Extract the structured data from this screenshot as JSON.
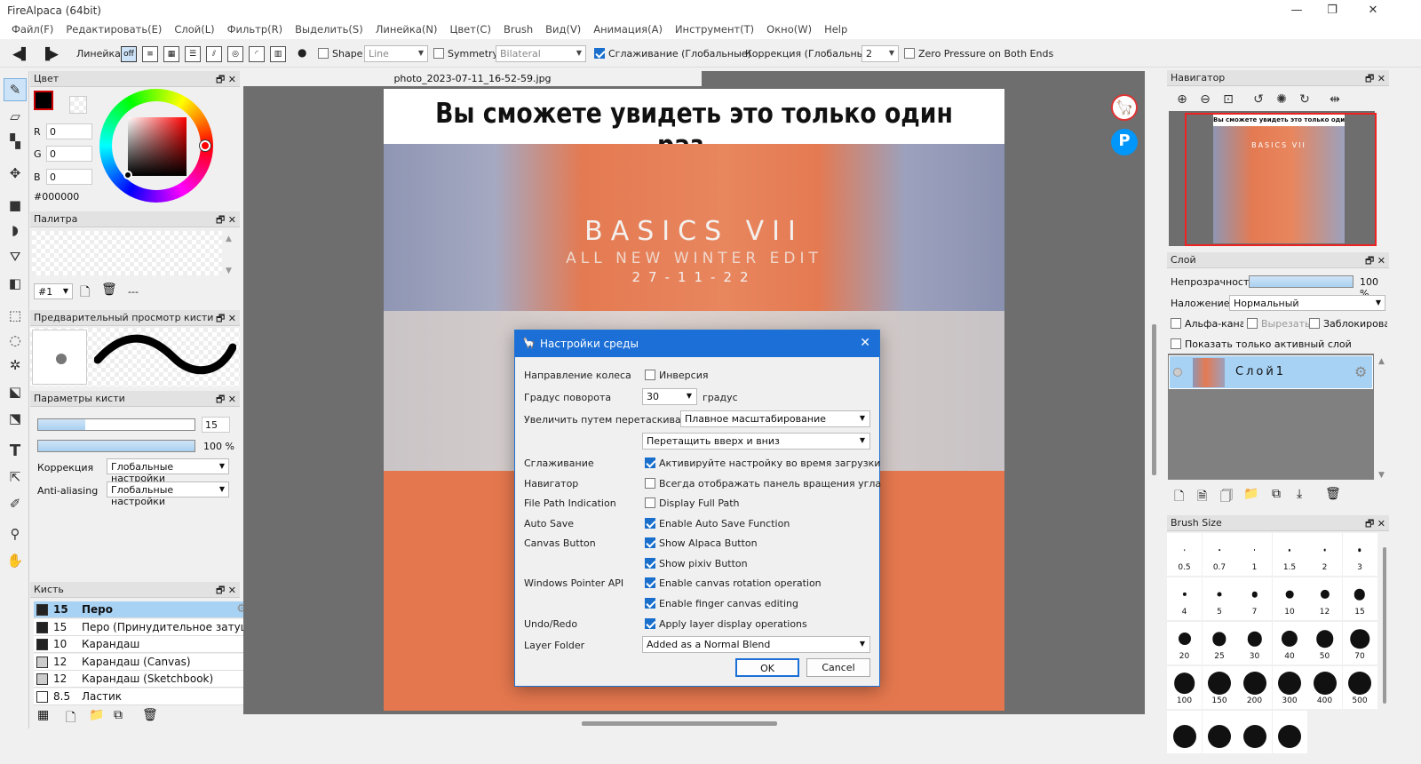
{
  "window": {
    "title": "FireAlpaca (64bit)"
  },
  "menu": [
    "Файл(F)",
    "Редактировать(E)",
    "Слой(L)",
    "Фильтр(R)",
    "Выделить(S)",
    "Линейка(N)",
    "Цвет(C)",
    "Brush",
    "Вид(V)",
    "Анимация(A)",
    "Инструмент(T)",
    "Окно(W)",
    "Help"
  ],
  "toolbar": {
    "ruler_label": "Линейка",
    "ruler_off": "off",
    "shape_label": "Shape",
    "shape_value": "Line",
    "symmetry_label": "Symmetry",
    "symmetry_value": "Bilateral",
    "smoothing_label": "Сглаживание (Глобальные)",
    "correction_label": "Коррекция (Глобальные)",
    "correction_value": "2",
    "zero_pressure_label": "Zero Pressure on Both Ends"
  },
  "color_panel": {
    "title": "Цвет",
    "r_label": "R",
    "g_label": "G",
    "b_label": "B",
    "r": "0",
    "g": "0",
    "b": "0",
    "hex": "#000000",
    "primary_color": "#000000"
  },
  "palette_panel": {
    "title": "Палитра",
    "index": "#1",
    "name": "---"
  },
  "brush_preview_panel": {
    "title": "Предварительный просмотр кисти"
  },
  "brush_params_panel": {
    "title": "Параметры кисти",
    "size": "15",
    "size_fraction": 0.3,
    "opacity": "100 %",
    "opacity_fraction": 1.0,
    "correction_label": "Коррекция",
    "correction_value": "Глобальные настройки",
    "aa_label": "Anti-aliasing",
    "aa_value": "Глобальные настройки"
  },
  "brush_panel": {
    "title": "Кисть",
    "items": [
      {
        "size": "15",
        "name": "Перо",
        "active": true,
        "swatch": "#222222"
      },
      {
        "size": "15",
        "name": "Перо (Принудительное затушевывание)",
        "swatch": "#222222"
      },
      {
        "size": "10",
        "name": "Карандаш",
        "swatch": "#222222"
      },
      {
        "size": "12",
        "name": "Карандаш (Canvas)",
        "swatch": "#cccccc"
      },
      {
        "size": "12",
        "name": "Карандаш (Sketchbook)",
        "swatch": "#cccccc"
      },
      {
        "size": "8.5",
        "name": "Ластик",
        "swatch": "#ffffff"
      }
    ]
  },
  "document": {
    "tab": "photo_2023-07-11_16-52-59.jpg",
    "caption": "Вы сможете увидеть это только один раз...",
    "art_title": "BASICS VII",
    "art_subtitle": "ALL NEW WINTER EDIT",
    "art_date": "27-11-22"
  },
  "dialog": {
    "title": "Настройки среды",
    "rows": [
      {
        "label": "Направление колеса",
        "check": false,
        "text": "Инверсия"
      },
      {
        "label": "Градус поворота",
        "dd": "30",
        "unit": "градус"
      },
      {
        "label": "Увеличить путем перетаскивания",
        "dd": "Плавное масштабирование"
      },
      {
        "label": "",
        "dd": "Перетащить вверх и вниз"
      },
      {
        "label": "Сглаживание",
        "check": true,
        "text": "Активируйте настройку во время загрузки"
      },
      {
        "label": "Навигатор",
        "check": false,
        "text": "Всегда отображать панель вращения угла"
      },
      {
        "label": "File Path Indication",
        "check": false,
        "text": "Display Full Path"
      },
      {
        "label": "Auto Save",
        "check": true,
        "text": "Enable Auto Save Function"
      },
      {
        "label": "Canvas Button",
        "check": true,
        "text": "Show Alpaca Button"
      },
      {
        "label": "",
        "check": true,
        "text": "Show pixiv Button"
      },
      {
        "label": "Windows Pointer API",
        "check": true,
        "text": "Enable canvas rotation operation"
      },
      {
        "label": "",
        "check": true,
        "text": "Enable finger canvas editing"
      },
      {
        "label": "Undo/Redo",
        "check": true,
        "text": "Apply layer display operations"
      },
      {
        "label": "Layer Folder",
        "dd": "Added as a Normal Blend"
      }
    ],
    "ok": "OK",
    "cancel": "Cancel"
  },
  "navigator_panel": {
    "title": "Навигатор",
    "thumb_caption": "Вы сможете увидеть это только один раз...",
    "thumb_title": "BASICS VII"
  },
  "layer_panel": {
    "title": "Слой",
    "opacity_label": "Непрозрачность",
    "opacity_value": "100 %",
    "opacity_fraction": 1.0,
    "blend_label": "Наложение",
    "blend_value": "Нормальный",
    "alpha_label": "Альфа-кана.",
    "clip_label": "Вырезать",
    "lock_label": "Заблокировать",
    "show_active_label": "Показать только активный слой",
    "layer_name": "Слой1"
  },
  "brush_size_panel": {
    "title": "Brush Size",
    "sizes": [
      "0.5",
      "0.7",
      "1",
      "1.5",
      "2",
      "3",
      "4",
      "5",
      "7",
      "10",
      "12",
      "15",
      "20",
      "25",
      "30",
      "40",
      "50",
      "70",
      "100",
      "150",
      "200",
      "300",
      "400",
      "500",
      "",
      "",
      "",
      ""
    ]
  },
  "colors": {
    "accent": "#1b6fd6",
    "canvas_bg": "#6e6e6e",
    "art_orange": "#e47a52",
    "denim": "#8f96b3"
  }
}
